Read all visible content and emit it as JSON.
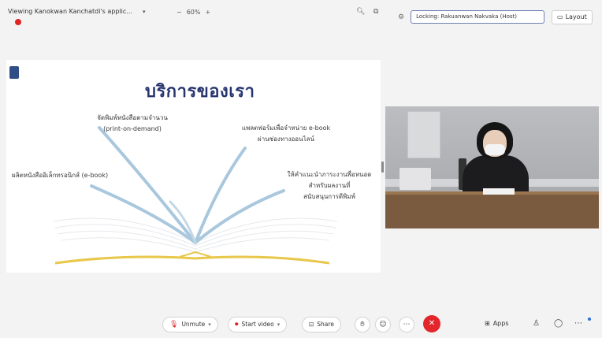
{
  "header": {
    "viewing_text": "Viewing Kanokwan Kanchatdi's applic...",
    "zoom_value": "60%",
    "zoom_minus": "−",
    "zoom_plus": "+",
    "locking_text": "Locking: Rakuanwan Nakvaka (Host)",
    "layout_label": "Layout"
  },
  "slide": {
    "title": "บริการของเรา",
    "items": [
      "จัดพิมพ์หนังสือตามจำนวน\n(print-on-demand)",
      "ผลิตหนังสืออิเล็กทรอนิกส์ (e-book)",
      "แพลตฟอร์มเพื่อจำหน่าย e-book\nผ่านช่องทางออนไลน์",
      "ให้คำแนะนำภาระงานพื่อหนอด\nสำหรับผลงานที่\nสนับสนุนการตีพิมพ์"
    ],
    "colors": {
      "title": "#27356f",
      "rays": "#a9c7dd",
      "book_gold": "#e8c74a"
    }
  },
  "toolbar": {
    "unmute_label": "Unmute",
    "start_video_label": "Start video",
    "share_label": "Share",
    "apps_label": "Apps"
  },
  "icons": [
    "record-dot-icon",
    "search-icon",
    "popout-icon",
    "lock-icon",
    "layout-icon",
    "mic-muted-icon",
    "video-off-icon",
    "share-icon",
    "raise-hand-icon",
    "reactions-icon",
    "more-icon",
    "end-call-icon",
    "apps-icon",
    "participants-icon",
    "chat-icon"
  ]
}
